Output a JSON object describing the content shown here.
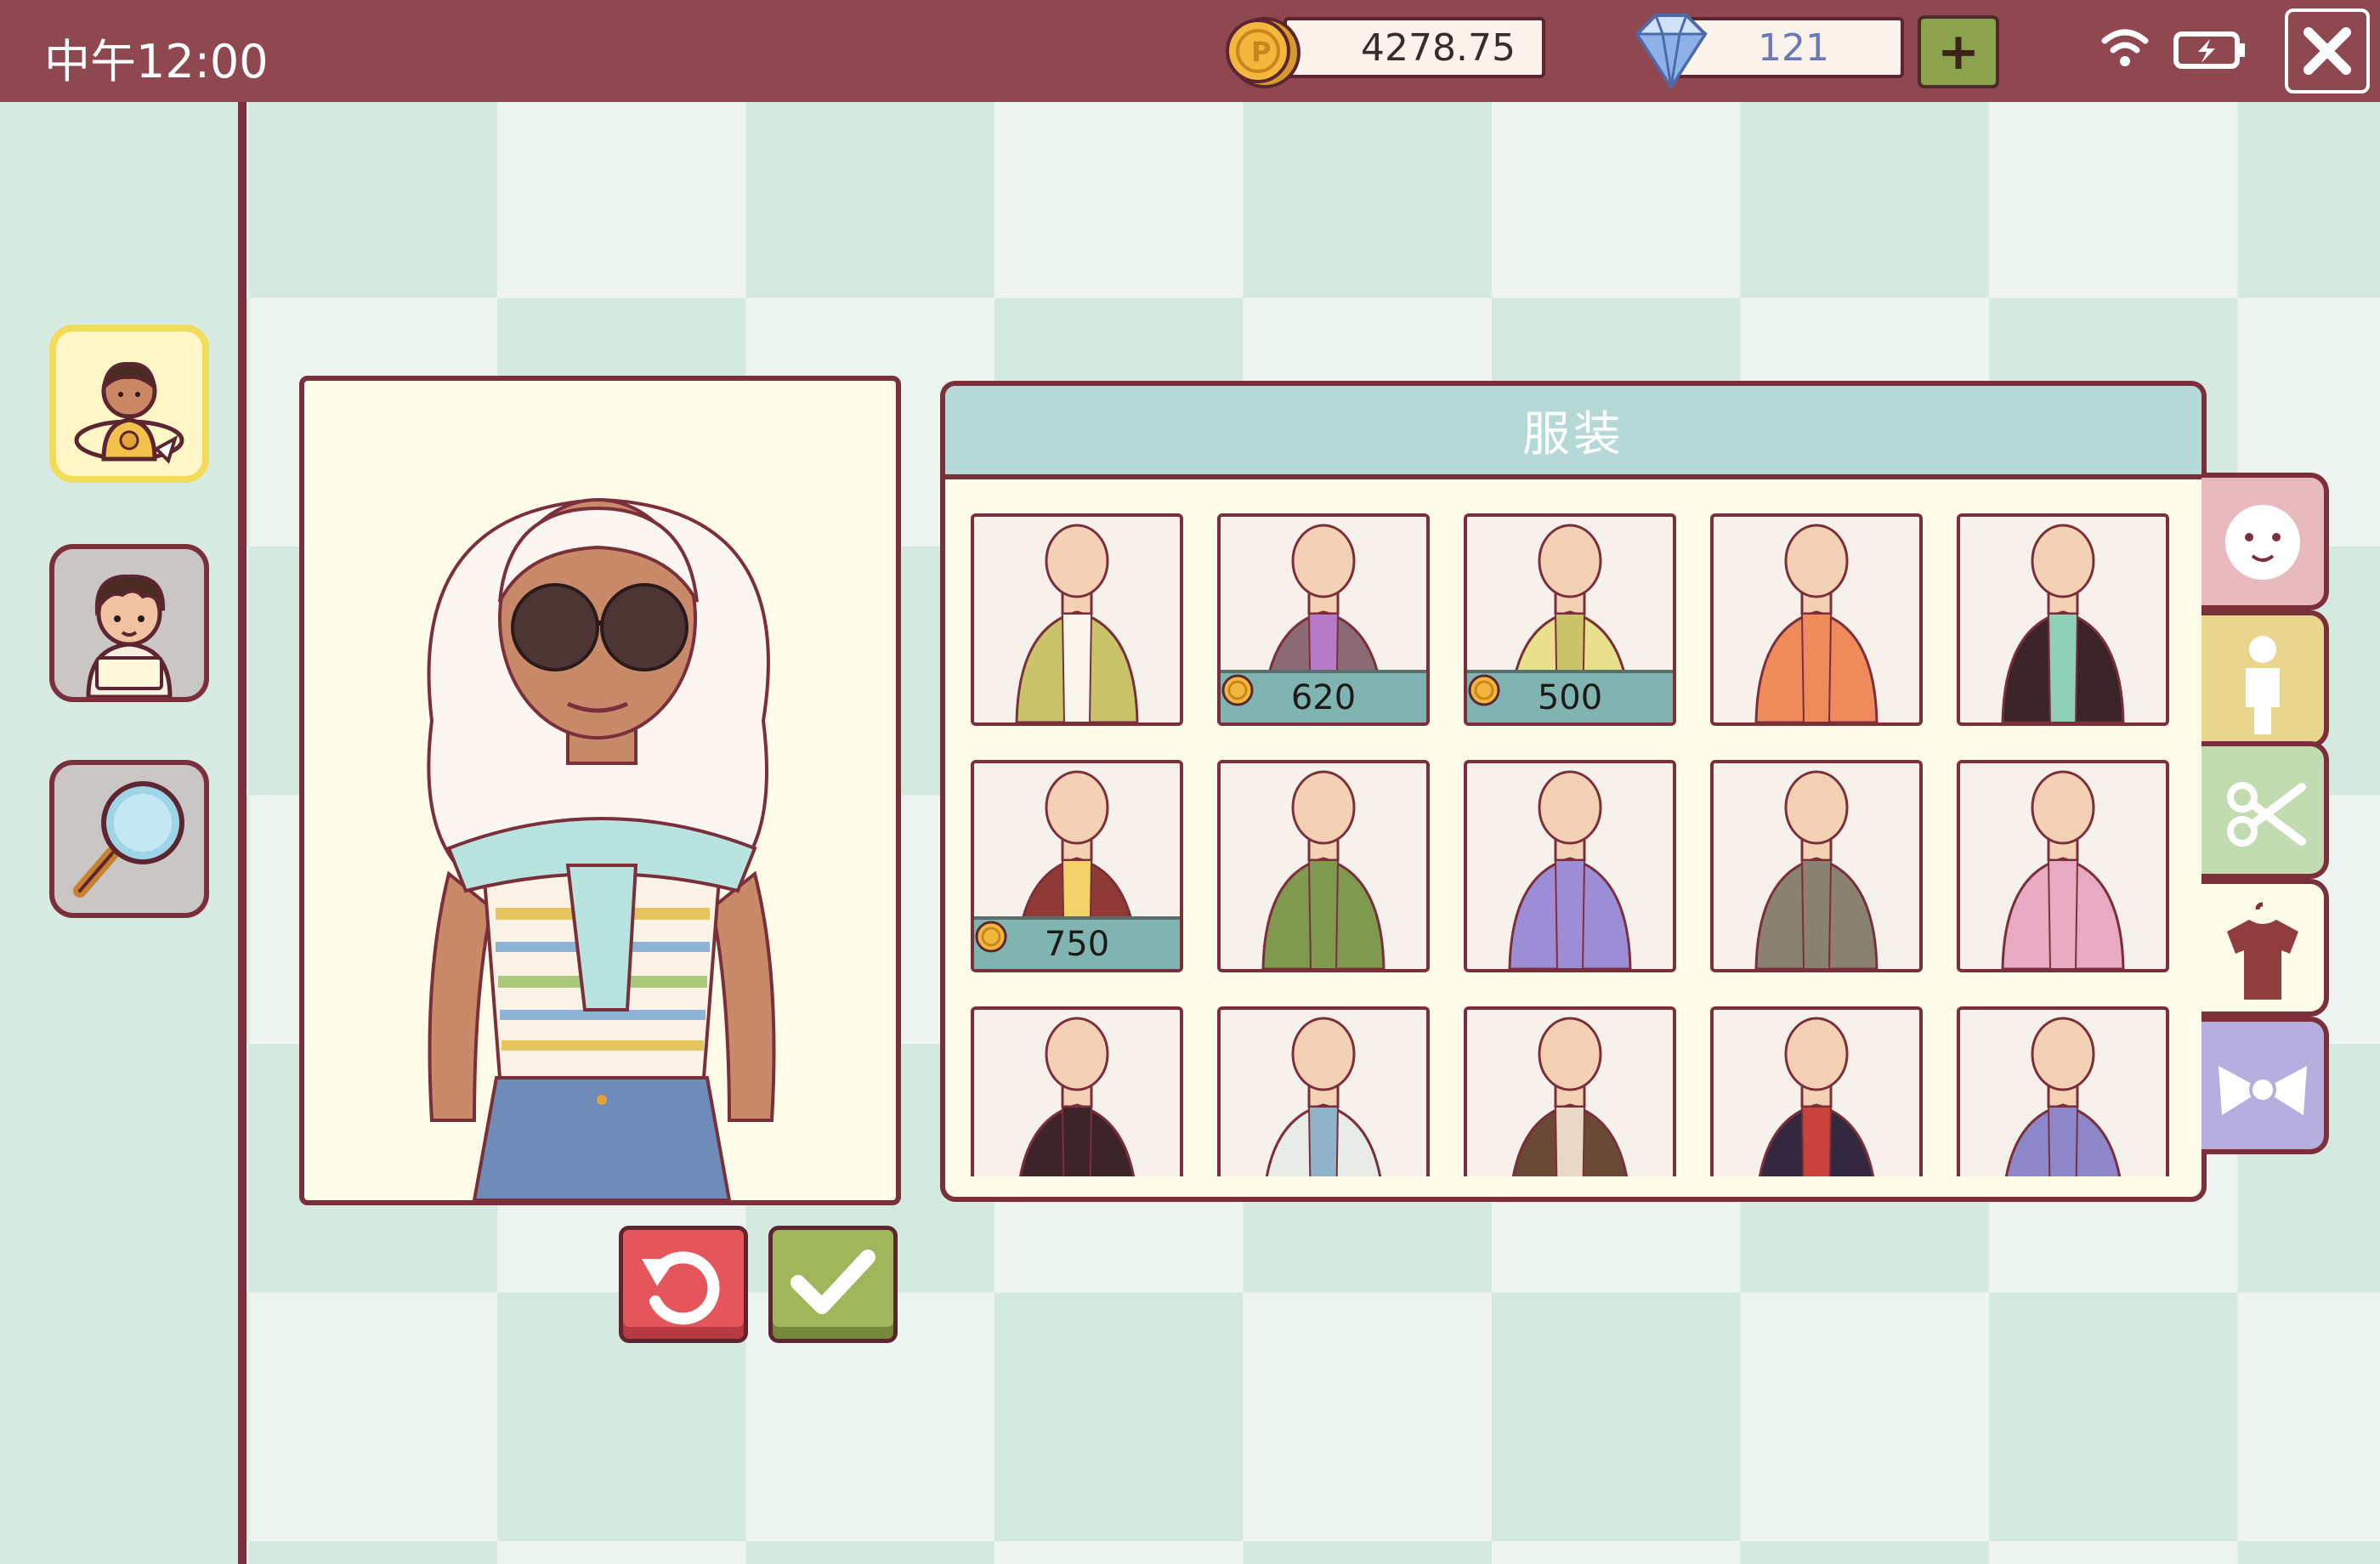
{
  "status_bar": {
    "time": "中午12:00"
  },
  "currency": {
    "coins": "4278.75",
    "gems": "121",
    "add_label": "+"
  },
  "panel": {
    "title": "服装"
  },
  "outfits": [
    {
      "id": "o1",
      "price": ""
    },
    {
      "id": "o2",
      "price": "620"
    },
    {
      "id": "o3",
      "price": "500"
    },
    {
      "id": "o4",
      "price": ""
    },
    {
      "id": "o5",
      "price": ""
    },
    {
      "id": "o6",
      "price": "750"
    },
    {
      "id": "o7",
      "price": ""
    },
    {
      "id": "o8",
      "price": ""
    },
    {
      "id": "o9",
      "price": ""
    },
    {
      "id": "o10",
      "price": ""
    }
  ],
  "tabs": [
    {
      "name": "face-tab",
      "icon": "face-icon",
      "color": "#e8b9bd"
    },
    {
      "name": "body-tab",
      "icon": "body-icon",
      "color": "#e9d58e"
    },
    {
      "name": "hair-tab",
      "icon": "scissors-icon",
      "color": "#c3dbb0"
    },
    {
      "name": "clothing-tab",
      "icon": "shirt-icon",
      "color": "#fffce9",
      "active": true
    },
    {
      "name": "accessory-tab",
      "icon": "bow-icon",
      "color": "#b5aede"
    }
  ],
  "colors": {
    "brand": "#8f4850",
    "outline": "#7a2f3b",
    "accent_teal": "#b4d9d6"
  }
}
